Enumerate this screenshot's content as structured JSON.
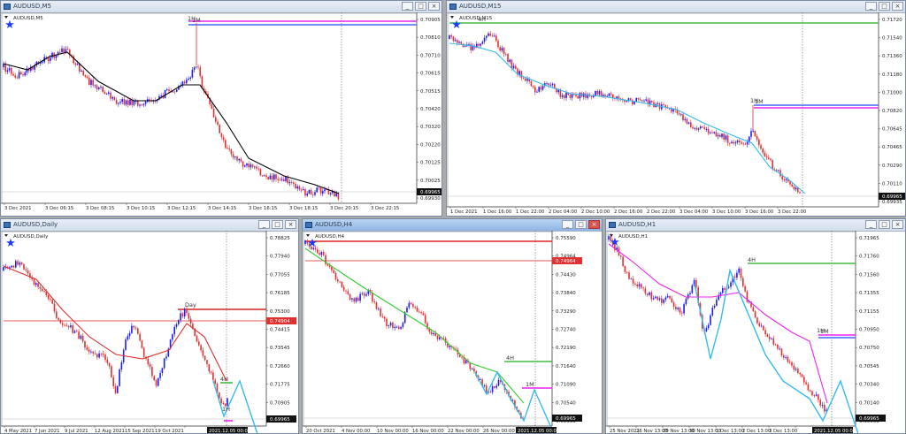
{
  "windows": [
    {
      "id": "w1",
      "title": "AUDUSD,M5",
      "symbol_label": "AUDUSD,M5",
      "active": false,
      "prices": [
        "0.70905",
        "0.70810",
        "0.70710",
        "0.70615",
        "0.70515",
        "0.70420",
        "0.70320",
        "0.70220",
        "0.70125",
        "0.70025",
        "0.69930"
      ],
      "dates": [
        "3 Dec 2021",
        "3 Dec 06:15",
        "3 Dec 08:15",
        "3 Dec 10:15",
        "3 Dec 12:15",
        "3 Dec 14:15",
        "3 Dec 16:15",
        "3 Dec 18:15",
        "3 Dec 20:15",
        "3 Dec 22:15"
      ],
      "tags": [
        "1H",
        "1M"
      ],
      "current_price": "0.69965",
      "chart_data": {
        "type": "line",
        "price_range": [
          0.6993,
          0.7095
        ]
      }
    },
    {
      "id": "w2",
      "title": "AUDUSD,M15",
      "symbol_label": "AUDUSD,M15",
      "active": false,
      "prices": [
        "0.71720",
        "0.71540",
        "0.71360",
        "0.71180",
        "0.71000",
        "0.70820",
        "0.70645",
        "0.70465",
        "0.70290",
        "0.70110",
        "0.69935"
      ],
      "dates": [
        "1 Dec 2021",
        "1 Dec 16:00",
        "1 Dec 22:00",
        "2 Dec 04:00",
        "2 Dec 10:00",
        "2 Dec 16:00",
        "2 Dec 22:00",
        "3 Dec 04:00",
        "3 Dec 10:00",
        "3 Dec 16:00",
        "3 Dec 22:00"
      ],
      "tags": [
        "4H",
        "1H",
        "1M"
      ],
      "current_price": "0.69965",
      "chart_data": {
        "type": "line",
        "price_range": [
          0.6992,
          0.7174
        ]
      }
    },
    {
      "id": "w3",
      "title": "AUDUSD,Daily",
      "symbol_label": "AUDUSD,Daily",
      "active": false,
      "prices": [
        "0.78825",
        "0.77940",
        "0.77055",
        "0.76185",
        "0.75300",
        "0.74415",
        "0.73545",
        "0.72660",
        "0.71775",
        "0.70905",
        "0.69965"
      ],
      "dates": [
        "4 May 2021",
        "7 Jun 2021",
        "9 Jul 2021",
        "12 Aug 2021",
        "15 Sep 2021",
        "19 Oct 2021",
        "2021.12.05 00:00"
      ],
      "tags": [
        "Day",
        "4H",
        "1H"
      ],
      "red_price": "0.74904",
      "current_price": "0.69965",
      "chart_data": {
        "type": "line",
        "price_range": [
          0.699,
          0.7895
        ]
      }
    },
    {
      "id": "w4",
      "title": "AUDUSD,H4",
      "symbol_label": "AUDUSD,H4",
      "active": true,
      "prices": [
        "0.75590",
        "0.74964",
        "0.74430",
        "0.73840",
        "0.73290",
        "0.72740",
        "0.72190",
        "0.71640",
        "0.71090",
        "0.70540",
        "0.69965"
      ],
      "dates": [
        "20 Oct 2021",
        "4 Nov 00:00",
        "10 Nov 00:00",
        "16 Nov 00:00",
        "22 Nov 00:00",
        "26 Nov 00:00",
        "2021.12.05 00:00"
      ],
      "tags": [
        "4H",
        "1M"
      ],
      "red_price": "0.74964",
      "current_price": "0.69965",
      "chart_data": {
        "type": "line",
        "price_range": [
          0.699,
          0.7565
        ]
      }
    },
    {
      "id": "w5",
      "title": "AUDUSD,H1",
      "symbol_label": "AUDUSD,H1",
      "active": false,
      "prices": [
        "0.71965",
        "0.71760",
        "0.71560",
        "0.71355",
        "0.71155",
        "0.70950",
        "0.70750",
        "0.70545",
        "0.70340",
        "0.70140",
        "0.69965"
      ],
      "dates": [
        "25 Nov 2021",
        "26 Nov 13:00",
        "29 Nov 13:00",
        "30 Nov 13:00",
        "1 Dec 13:00",
        "2 Dec 13:00",
        "3 Dec 13:00",
        "2021.12.05 00:00"
      ],
      "tags": [
        "4H",
        "1H",
        "1M"
      ],
      "current_price": "0.69965",
      "chart_data": {
        "type": "line",
        "price_range": [
          0.699,
          0.72
        ]
      }
    }
  ],
  "buttons": {
    "min": "_",
    "max": "□",
    "close": "×"
  },
  "colors": {
    "bull": "#1a1aff",
    "bear": "#e03030",
    "ma_black": "#000000",
    "ma_cyan": "#33bbee",
    "ma_red": "#e03030",
    "ma_green": "#33cc33",
    "ma_magenta": "#ee22ee",
    "level_magenta": "#ee22ee",
    "level_blue": "#4466ff",
    "level_green": "#44bb44",
    "level_red": "#dd2222",
    "star": "#1a3cff"
  }
}
